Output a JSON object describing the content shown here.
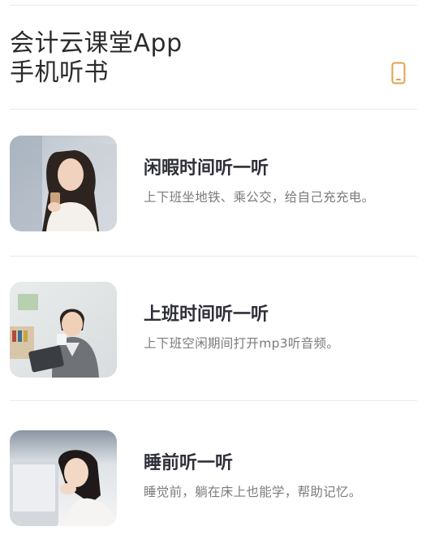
{
  "header": {
    "title_line1": "会计云课堂App",
    "title_line2": "手机听书",
    "icon": "phone-icon",
    "accent_color": "#e2a24a"
  },
  "items": [
    {
      "title": "闲暇时间听一听",
      "desc": "上下班坐地铁、乘公交，给自己充充电。",
      "image": "woman-with-phone-photo"
    },
    {
      "title": "上班时间听一听",
      "desc": "上下班空闲期间打开mp3听音频。",
      "image": "man-with-tablet-photo"
    },
    {
      "title": "睡前听一听",
      "desc": "睡觉前，躺在床上也能学，帮助记忆。",
      "image": "woman-resting-photo"
    }
  ]
}
